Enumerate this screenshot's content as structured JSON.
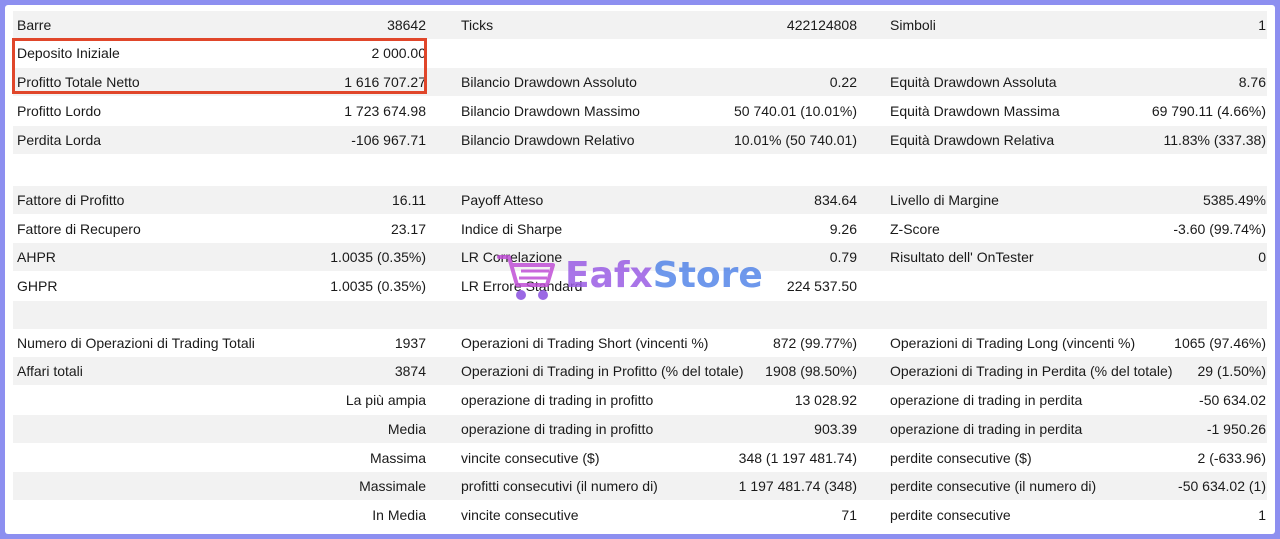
{
  "rows": [
    {
      "l1": "Barre",
      "v1": "38642",
      "l2": "Ticks",
      "v2": "422124808",
      "l3": "Simboli",
      "v3": "1"
    },
    {
      "l1": "Deposito Iniziale",
      "v1": "2 000.00",
      "l2": "",
      "v2": "",
      "l3": "",
      "v3": ""
    },
    {
      "l1": "Profitto Totale Netto",
      "v1": "1 616 707.27",
      "l2": "Bilancio Drawdown Assoluto",
      "v2": "0.22",
      "l3": "Equità Drawdown Assoluta",
      "v3": "8.76"
    },
    {
      "l1": "Profitto Lordo",
      "v1": "1 723 674.98",
      "l2": "Bilancio Drawdown Massimo",
      "v2": "50 740.01 (10.01%)",
      "l3": "Equità Drawdown Massima",
      "v3": "69 790.11 (4.66%)"
    },
    {
      "l1": "Perdita Lorda",
      "v1": "-106 967.71",
      "l2": "Bilancio Drawdown Relativo",
      "v2": "10.01% (50 740.01)",
      "l3": "Equità Drawdown Relativa",
      "v3": "11.83% (337.38)"
    },
    {
      "l1": "",
      "v1": "",
      "l2": "",
      "v2": "",
      "l3": "",
      "v3": ""
    },
    {
      "l1": "Fattore di Profitto",
      "v1": "16.11",
      "l2": "Payoff Atteso",
      "v2": "834.64",
      "l3": "Livello di Margine",
      "v3": "5385.49%"
    },
    {
      "l1": "Fattore di Recupero",
      "v1": "23.17",
      "l2": "Indice di Sharpe",
      "v2": "9.26",
      "l3": "Z-Score",
      "v3": "-3.60 (99.74%)"
    },
    {
      "l1": "AHPR",
      "v1": "1.0035 (0.35%)",
      "l2": "LR Correlazione",
      "v2": "0.79",
      "l3": "Risultato dell' OnTester",
      "v3": "0"
    },
    {
      "l1": "GHPR",
      "v1": "1.0035 (0.35%)",
      "l2": "LR Errore Standard",
      "v2": "224 537.50",
      "l3": "",
      "v3": ""
    },
    {
      "l1": "",
      "v1": "",
      "l2": "",
      "v2": "",
      "l3": "",
      "v3": ""
    },
    {
      "l1": "Numero di Operazioni di Trading Totali",
      "v1": "1937",
      "l2": "Operazioni di Trading Short (vincenti %)",
      "v2": "872 (99.77%)",
      "l3": "Operazioni di Trading Long (vincenti %)",
      "v3": "1065 (97.46%)"
    },
    {
      "l1": "Affari totali",
      "v1": "3874",
      "l2": "Operazioni di Trading in Profitto (% del totale)",
      "v2": "1908 (98.50%)",
      "l3": "Operazioni di Trading in Perdita (% del totale)",
      "v3": "29 (1.50%)"
    },
    {
      "l1": "",
      "v1": "La più ampia",
      "l2": "operazione di trading in profitto",
      "v2": "13 028.92",
      "l3": "operazione di trading in perdita",
      "v3": "-50 634.02"
    },
    {
      "l1": "",
      "v1": "Media",
      "l2": "operazione di trading in profitto",
      "v2": "903.39",
      "l3": "operazione di trading in perdita",
      "v3": "-1 950.26"
    },
    {
      "l1": "",
      "v1": "Massima",
      "l2": "vincite consecutive ($)",
      "v2": "348 (1 197 481.74)",
      "l3": "perdite consecutive ($)",
      "v3": "2 (-633.96)"
    },
    {
      "l1": "",
      "v1": "Massimale",
      "l2": "profitti consecutivi (il numero di)",
      "v2": "1 197 481.74 (348)",
      "l3": "perdite consecutive (il numero di)",
      "v3": "-50 634.02 (1)"
    },
    {
      "l1": "",
      "v1": "In Media",
      "l2": "vincite consecutive",
      "v2": "71",
      "l3": "perdite consecutive",
      "v3": "1"
    }
  ],
  "watermark": {
    "part1": "Eafx",
    "part2": "Store",
    "icon": "shopping-cart-icon"
  },
  "colors": {
    "highlight": "#e0462a",
    "frame": "#8d8ff0",
    "stripe": "#f2f2f2"
  }
}
